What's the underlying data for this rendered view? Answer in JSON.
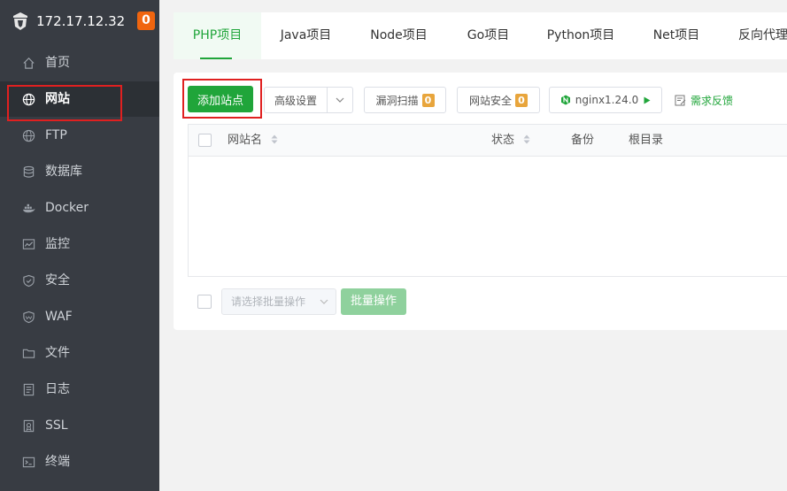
{
  "brand": {
    "ip": "172.17.12.32",
    "badge": "0"
  },
  "sidebar": {
    "items": [
      {
        "label": "首页",
        "icon": "home-icon"
      },
      {
        "label": "网站",
        "icon": "globe-icon",
        "active": true
      },
      {
        "label": "FTP",
        "icon": "ftp-globe-icon"
      },
      {
        "label": "数据库",
        "icon": "database-icon"
      },
      {
        "label": "Docker",
        "icon": "docker-icon"
      },
      {
        "label": "监控",
        "icon": "monitor-icon"
      },
      {
        "label": "安全",
        "icon": "shield-icon"
      },
      {
        "label": "WAF",
        "icon": "waf-shield-icon"
      },
      {
        "label": "文件",
        "icon": "folder-icon"
      },
      {
        "label": "日志",
        "icon": "log-icon"
      },
      {
        "label": "SSL",
        "icon": "ssl-icon"
      },
      {
        "label": "终端",
        "icon": "terminal-icon"
      }
    ]
  },
  "tabs": [
    {
      "label": "PHP项目",
      "active": true
    },
    {
      "label": "Java项目"
    },
    {
      "label": "Node项目"
    },
    {
      "label": "Go项目"
    },
    {
      "label": "Python项目"
    },
    {
      "label": "Net项目"
    },
    {
      "label": "反向代理"
    }
  ],
  "toolbar": {
    "add_site": "添加站点",
    "advanced": "高级设置",
    "vuln_scan": "漏洞扫描",
    "vuln_count": "0",
    "site_security": "网站安全",
    "security_count": "0",
    "nginx": "nginx1.24.0",
    "feedback": "需求反馈"
  },
  "table": {
    "columns": [
      "网站名",
      "状态",
      "备份",
      "根目录"
    ]
  },
  "batch": {
    "placeholder": "请选择批量操作",
    "button": "批量操作"
  },
  "colors": {
    "accent": "#20a53a",
    "sidebar": "#383c43",
    "badge": "#f0650f",
    "highlight": "#e02020"
  }
}
